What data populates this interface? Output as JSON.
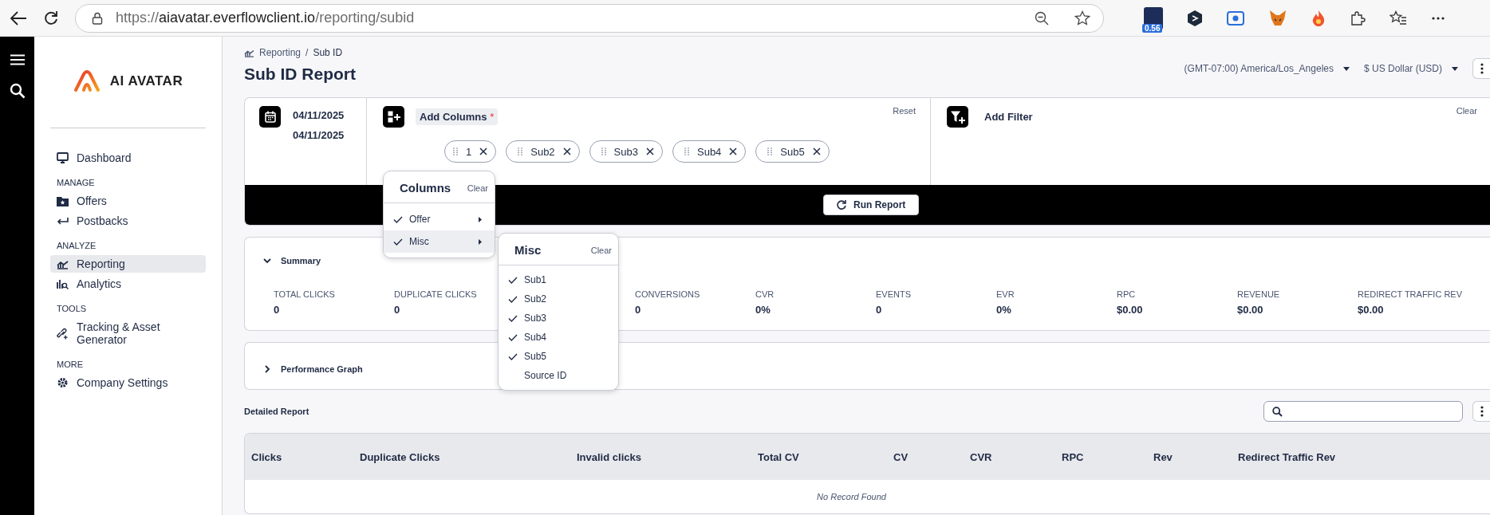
{
  "browser": {
    "url_scheme": "https://",
    "url_host": "aiavatar.everflowclient.io",
    "url_path": "/reporting/subid",
    "extension_badge": "0.56"
  },
  "sidebar": {
    "logo_text": "AI AVATAR",
    "groups": [
      {
        "items": [
          {
            "label": "Dashboard",
            "kind": "monitor",
            "selected": false
          }
        ]
      },
      {
        "heading": "MANAGE",
        "items": [
          {
            "label": "Offers",
            "kind": "folder",
            "selected": false
          },
          {
            "label": "Postbacks",
            "kind": "return",
            "selected": false
          }
        ]
      },
      {
        "heading": "ANALYZE",
        "items": [
          {
            "label": "Reporting",
            "kind": "chart",
            "selected": true
          },
          {
            "label": "Analytics",
            "kind": "analytics",
            "selected": false
          }
        ]
      },
      {
        "heading": "TOOLS",
        "items": [
          {
            "label": "Tracking & Asset Generator",
            "kind": "link",
            "selected": false
          }
        ]
      },
      {
        "heading": "MORE",
        "items": [
          {
            "label": "Company Settings",
            "kind": "gear",
            "selected": false
          }
        ]
      }
    ]
  },
  "breadcrumb": [
    "Reporting",
    "Sub ID"
  ],
  "breadcrumb_separator": "/",
  "title": "Sub ID Report",
  "timezone": "(GMT-07:00) America/Los_Angeles",
  "currency": "$ US Dollar (USD)",
  "date_range": [
    "04/11/2025",
    "04/11/2025"
  ],
  "columns": {
    "label": "Add Columns",
    "required_mark": "*",
    "reset": "Reset",
    "chips": [
      "1",
      "Sub2",
      "Sub3",
      "Sub4",
      "Sub5"
    ]
  },
  "filter": {
    "label": "Add Filter",
    "clear": "Clear"
  },
  "run_button": "Run Report",
  "columns_menu": {
    "title": "Columns",
    "clear": "Clear",
    "items": [
      {
        "label": "Offer",
        "checked": true,
        "selected": false
      },
      {
        "label": "Misc",
        "checked": true,
        "selected": true
      }
    ]
  },
  "misc_menu": {
    "title": "Misc",
    "clear": "Clear",
    "items": [
      {
        "label": "Sub1",
        "checked": true
      },
      {
        "label": "Sub2",
        "checked": true
      },
      {
        "label": "Sub3",
        "checked": true
      },
      {
        "label": "Sub4",
        "checked": true
      },
      {
        "label": "Sub5",
        "checked": true
      },
      {
        "label": "Source ID",
        "checked": false
      }
    ]
  },
  "summary": {
    "title": "Summary",
    "expanded": true,
    "metrics": [
      {
        "label": "TOTAL CLICKS",
        "value": "0"
      },
      {
        "label": "DUPLICATE CLICKS",
        "value": "0"
      },
      {
        "label": "CONVERSIONS",
        "value": "0"
      },
      {
        "label": "CVR",
        "value": "0%"
      },
      {
        "label": "EVENTS",
        "value": "0"
      },
      {
        "label": "EVR",
        "value": "0%"
      },
      {
        "label": "RPC",
        "value": "$0.00"
      },
      {
        "label": "REVENUE",
        "value": "$0.00"
      },
      {
        "label": "REDIRECT TRAFFIC REV",
        "value": "$0.00"
      }
    ]
  },
  "performance_graph": {
    "title": "Performance Graph",
    "expanded": false
  },
  "detailed_report": {
    "title": "Detailed Report",
    "columns": [
      "Clicks",
      "Duplicate Clicks",
      "Invalid clicks",
      "Total CV",
      "CV",
      "CVR",
      "RPC",
      "Rev",
      "Redirect Traffic Rev"
    ],
    "empty_message": "No Record Found"
  }
}
